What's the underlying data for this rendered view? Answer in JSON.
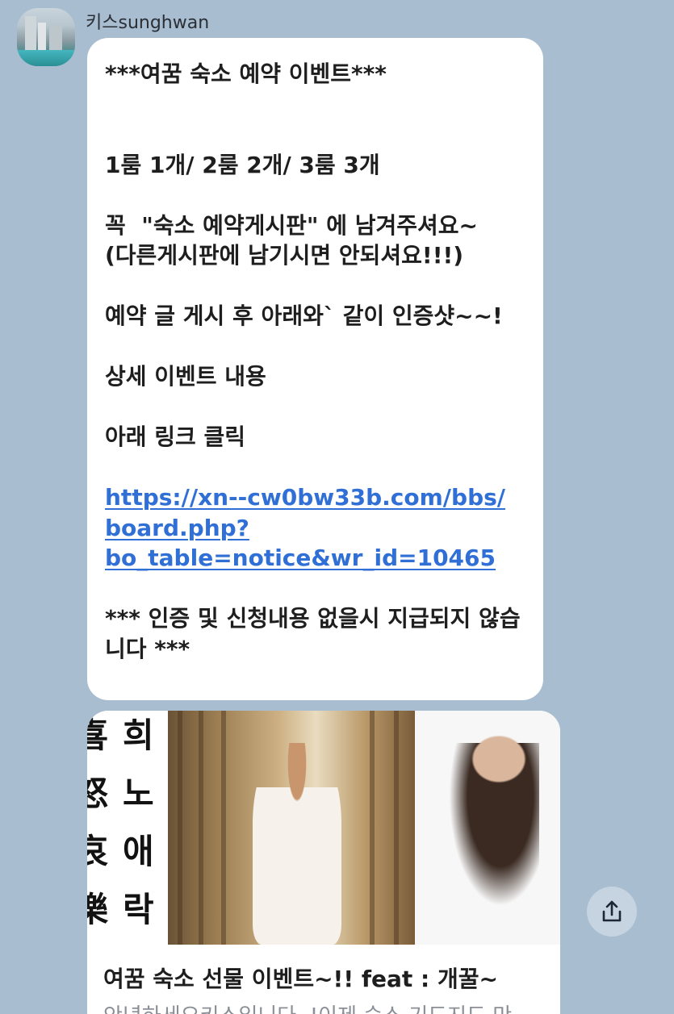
{
  "chat": {
    "sender_name": "키스sunghwan",
    "message_lines": [
      "***여꿈 숙소 예약 이벤트***",
      "",
      "",
      "1룸 1개/ 2룸 2개/ 3룸 3개",
      "",
      "꼭  \"숙소 예약게시판\" 에 남겨주셔요~",
      "(다른게시판에 남기시면 안되셔요!!!)",
      "",
      "예약 글 게시 후 아래와` 같이 인증샷~~!",
      "",
      "상세 이벤트 내용",
      "",
      "아래 링크 클릭",
      ""
    ],
    "link_lines": [
      "https://xn--cw0bw33b.com/bbs/",
      "board.php?",
      "bo_table=notice&wr_id=10465"
    ],
    "footer_lines": [
      "",
      "*** 인증 및 신청내용 없을시 지급되지 않습",
      "니다 ***"
    ]
  },
  "preview_card": {
    "calligraphy_left": [
      "喜",
      "怒",
      "哀",
      "樂"
    ],
    "calligraphy_right": [
      "희",
      "노",
      "애",
      "락"
    ],
    "title": "여꿈 숙소 선물 이벤트~!! feat : 개꿀~",
    "description": "안녕하세요키스입니다. !이제 숙소 기도지도 만"
  },
  "icons": {
    "share": "share-icon",
    "avatar": "avatar"
  },
  "colors": {
    "background": "#a8bdd0",
    "link": "#2f6fd6",
    "share_button": "#c6d4e1"
  }
}
